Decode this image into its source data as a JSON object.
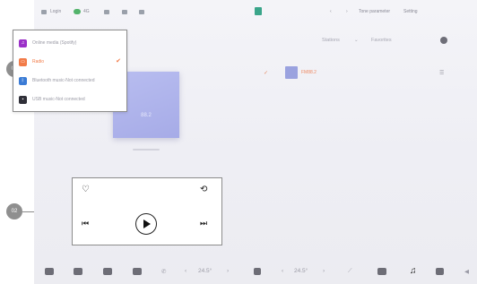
{
  "status_bar": {
    "left_text": "Login",
    "network_text": "4G",
    "center_right_text": "Tone parameter",
    "right_text": "Setting"
  },
  "source_menu": {
    "items": [
      {
        "label": "Online media (Spotify)",
        "icon": "music-app-icon",
        "color": "#9b30c8",
        "selected": false
      },
      {
        "label": "Radio",
        "icon": "radio-icon",
        "color": "#f27b48",
        "selected": true
      },
      {
        "label": "Bluetooth music-Not connected",
        "icon": "bluetooth-icon",
        "color": "#3a7bd5",
        "selected": false
      },
      {
        "label": "USB music-Not connected",
        "icon": "usb-drive-icon",
        "color": "#2f2f38",
        "selected": false
      }
    ],
    "checkmark": "✔"
  },
  "radio": {
    "tabs": {
      "stations": "Stations",
      "favorites": "Favorites"
    },
    "station_name": "FM88.2",
    "album_label": "88.2"
  },
  "player": {
    "favorite_icon": "♡",
    "history_icon": "⟲",
    "prev_icon": "⏮",
    "next_icon": "⏭"
  },
  "callouts": {
    "first": "01",
    "second": "02"
  },
  "dock": {
    "left_temp": "24.5°",
    "right_temp": "24.5°",
    "music_icon": "♫"
  },
  "colors": {
    "accent": "#f27b48",
    "album": "#a6abe7"
  }
}
